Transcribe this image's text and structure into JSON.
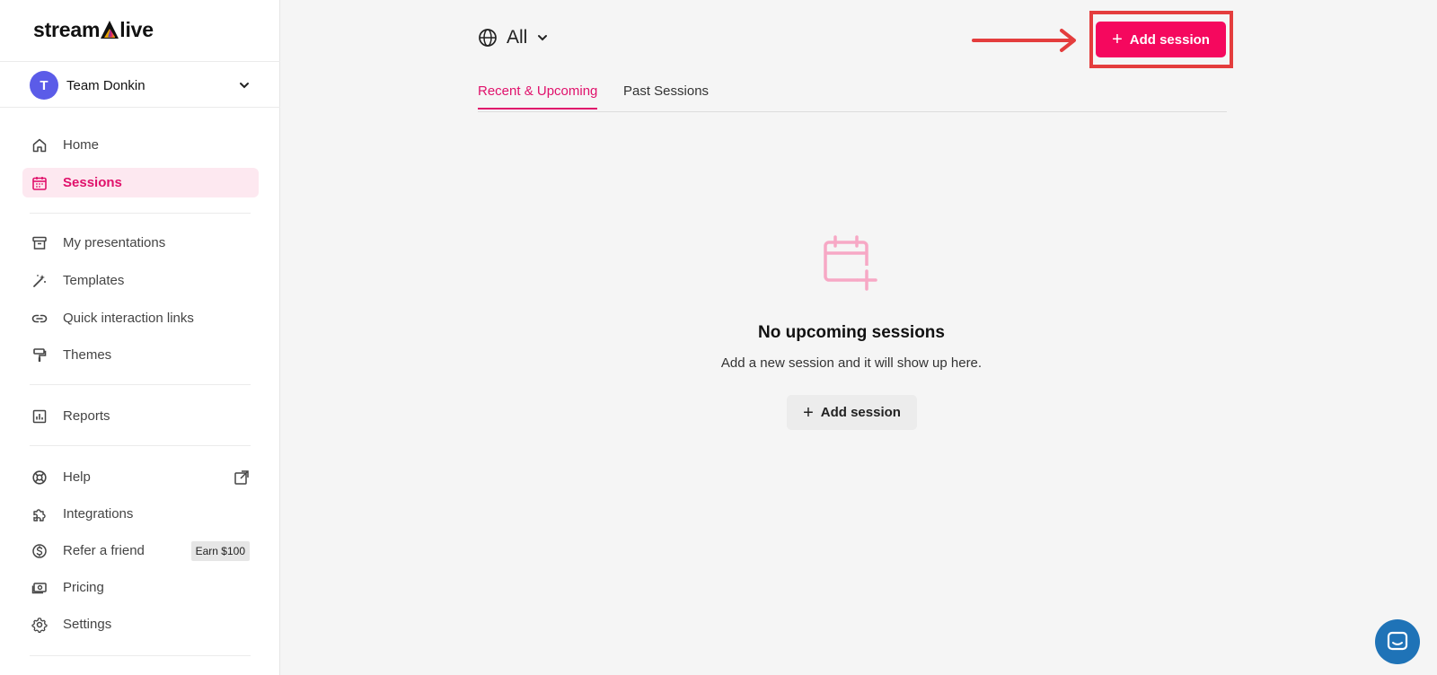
{
  "brand": {
    "logo_prefix": "stream",
    "logo_suffix": "live"
  },
  "team": {
    "initial": "T",
    "name": "Team Donkin"
  },
  "nav": {
    "home": "Home",
    "sessions": "Sessions",
    "presentations": "My presentations",
    "templates": "Templates",
    "quick_links": "Quick interaction links",
    "themes": "Themes",
    "reports": "Reports",
    "help": "Help",
    "integrations": "Integrations",
    "refer": "Refer a friend",
    "refer_badge": "Earn $100",
    "pricing": "Pricing",
    "settings": "Settings"
  },
  "filter": {
    "label": "All"
  },
  "tabs": {
    "recent": "Recent & Upcoming",
    "past": "Past Sessions"
  },
  "actions": {
    "add_session": "Add session"
  },
  "empty": {
    "title": "No upcoming sessions",
    "subtitle": "Add a new session and it will show up here.",
    "button": "Add session"
  },
  "colors": {
    "accent": "#f5085e",
    "active_bg": "#fde8f0",
    "annotation": "#e43d3d",
    "chat": "#1f73b7"
  }
}
